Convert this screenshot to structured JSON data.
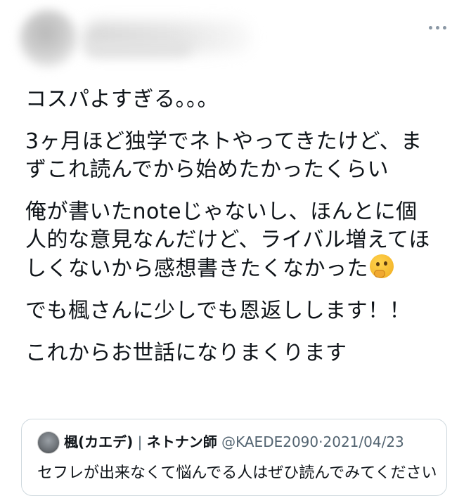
{
  "tweet": {
    "paragraphs": [
      "コスパよすぎる。。。",
      "3ヶ月ほど独学でネトやってきたけど、ま\nずこれ読んでから始めたかったくらい",
      "俺が書いたnoteじゃないし、ほんとに個\n人的な意見なんだけど、ライバル増えてほ\nしくないから感想書きたくなかった",
      "でも楓さんに少しでも恩返しします！！",
      "これからお世話になりまくります"
    ],
    "emoji": "thinking-face"
  },
  "quoted_tweet": {
    "author_name": "楓(カエデ)",
    "separator": "|",
    "author_title": "ネトナン師",
    "handle": "@KAEDE2090",
    "dot": "·",
    "date": "2021/04/23",
    "text": "セフレが出来なくて悩んでる人はぜひ読んでみてください"
  },
  "icons": {
    "more": "more-horizontal-icon"
  },
  "colors": {
    "text": "#0f1419",
    "secondary": "#536471",
    "border": "#cfd9de"
  }
}
